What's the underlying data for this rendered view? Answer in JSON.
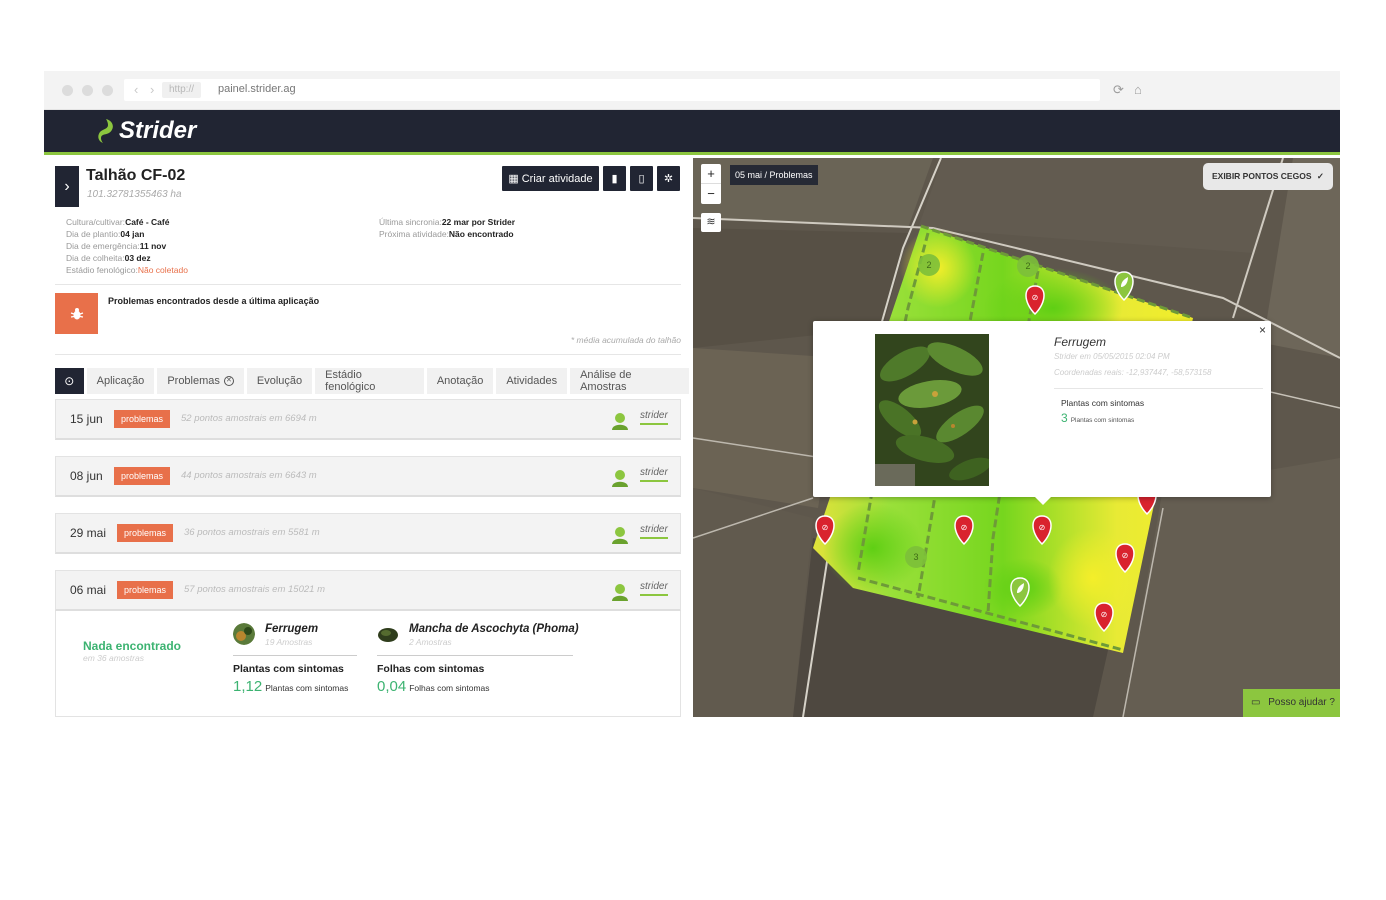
{
  "browser": {
    "protocol": "http://",
    "url": "painel.strider.ag"
  },
  "app": {
    "brand": "Strider"
  },
  "field": {
    "title": "Talhão CF-02",
    "area": "101.32781355463 ha",
    "create_activity_label": "Criar atividade",
    "info_left": [
      {
        "label": "Cultura/cultivar:",
        "value": "Café - Café"
      },
      {
        "label": "Dia de plantio:",
        "value": "04 jan"
      },
      {
        "label": "Dia de emergência:",
        "value": "11 nov"
      },
      {
        "label": "Dia de colheita:",
        "value": "03 dez"
      },
      {
        "label": "Estádio fenológico:",
        "value": "Não coletado"
      }
    ],
    "info_right": [
      {
        "label": "Última sincronia:",
        "value": "22 mar por Strider"
      },
      {
        "label": "Próxima atividade:",
        "value": "Não encontrado"
      }
    ],
    "alert_text": "Problemas encontrados desde a última aplicação",
    "avg_note": "* média acumulada do talhão"
  },
  "tabs": [
    "Aplicação",
    "Problemas",
    "Evolução",
    "Estádio fenológico",
    "Anotação",
    "Atividades",
    "Análise de Amostras"
  ],
  "records": [
    {
      "date": "15 jun",
      "badge": "problemas",
      "desc": "52 pontos amostrais em 6694 m",
      "user": "strider"
    },
    {
      "date": "08 jun",
      "badge": "problemas",
      "desc": "44 pontos amostrais em 6643 m",
      "user": "strider"
    },
    {
      "date": "29 mai",
      "badge": "problemas",
      "desc": "36 pontos amostrais em 5581 m",
      "user": "strider"
    },
    {
      "date": "06 mai",
      "badge": "problemas",
      "desc": "57 pontos amostrais em 15021 m",
      "user": "strider"
    }
  ],
  "expanded": {
    "nothing_found": "Nada encontrado",
    "nothing_sub": "em 36 amostras",
    "items": [
      {
        "name": "Ferrugem",
        "count": "19 Amostras",
        "metric": "Plantas com sintomas",
        "value": "1,12",
        "unit": "Plantas com sintomas"
      },
      {
        "name": "Mancha de Ascochyta (Phoma)",
        "count": "2 Amostras",
        "metric": "Folhas com sintomas",
        "value": "0,04",
        "unit": "Folhas com sintomas"
      }
    ]
  },
  "map": {
    "zoom_in": "+",
    "zoom_out": "−",
    "breadcrumb": "05 mai / Problemas",
    "blind_spots_label": "EXIBIR PONTOS CEGOS",
    "help_label": "Posso ajudar ?",
    "cluster_counts": [
      "2",
      "2",
      "3"
    ],
    "popup": {
      "close": "×",
      "title": "Ferrugem",
      "by": "Strider em 05/05/2015 02:04 PM",
      "coords": "Coordenadas reais: -12,937447, -58,573158",
      "metric": "Plantas com sintomas",
      "value": "3",
      "unit": "Plantas com sintomas"
    }
  },
  "colors": {
    "navy": "#212533",
    "green": "#8cc63f",
    "orange": "#e8704a",
    "value_green": "#3cb371",
    "pin_red": "#d9232e"
  }
}
